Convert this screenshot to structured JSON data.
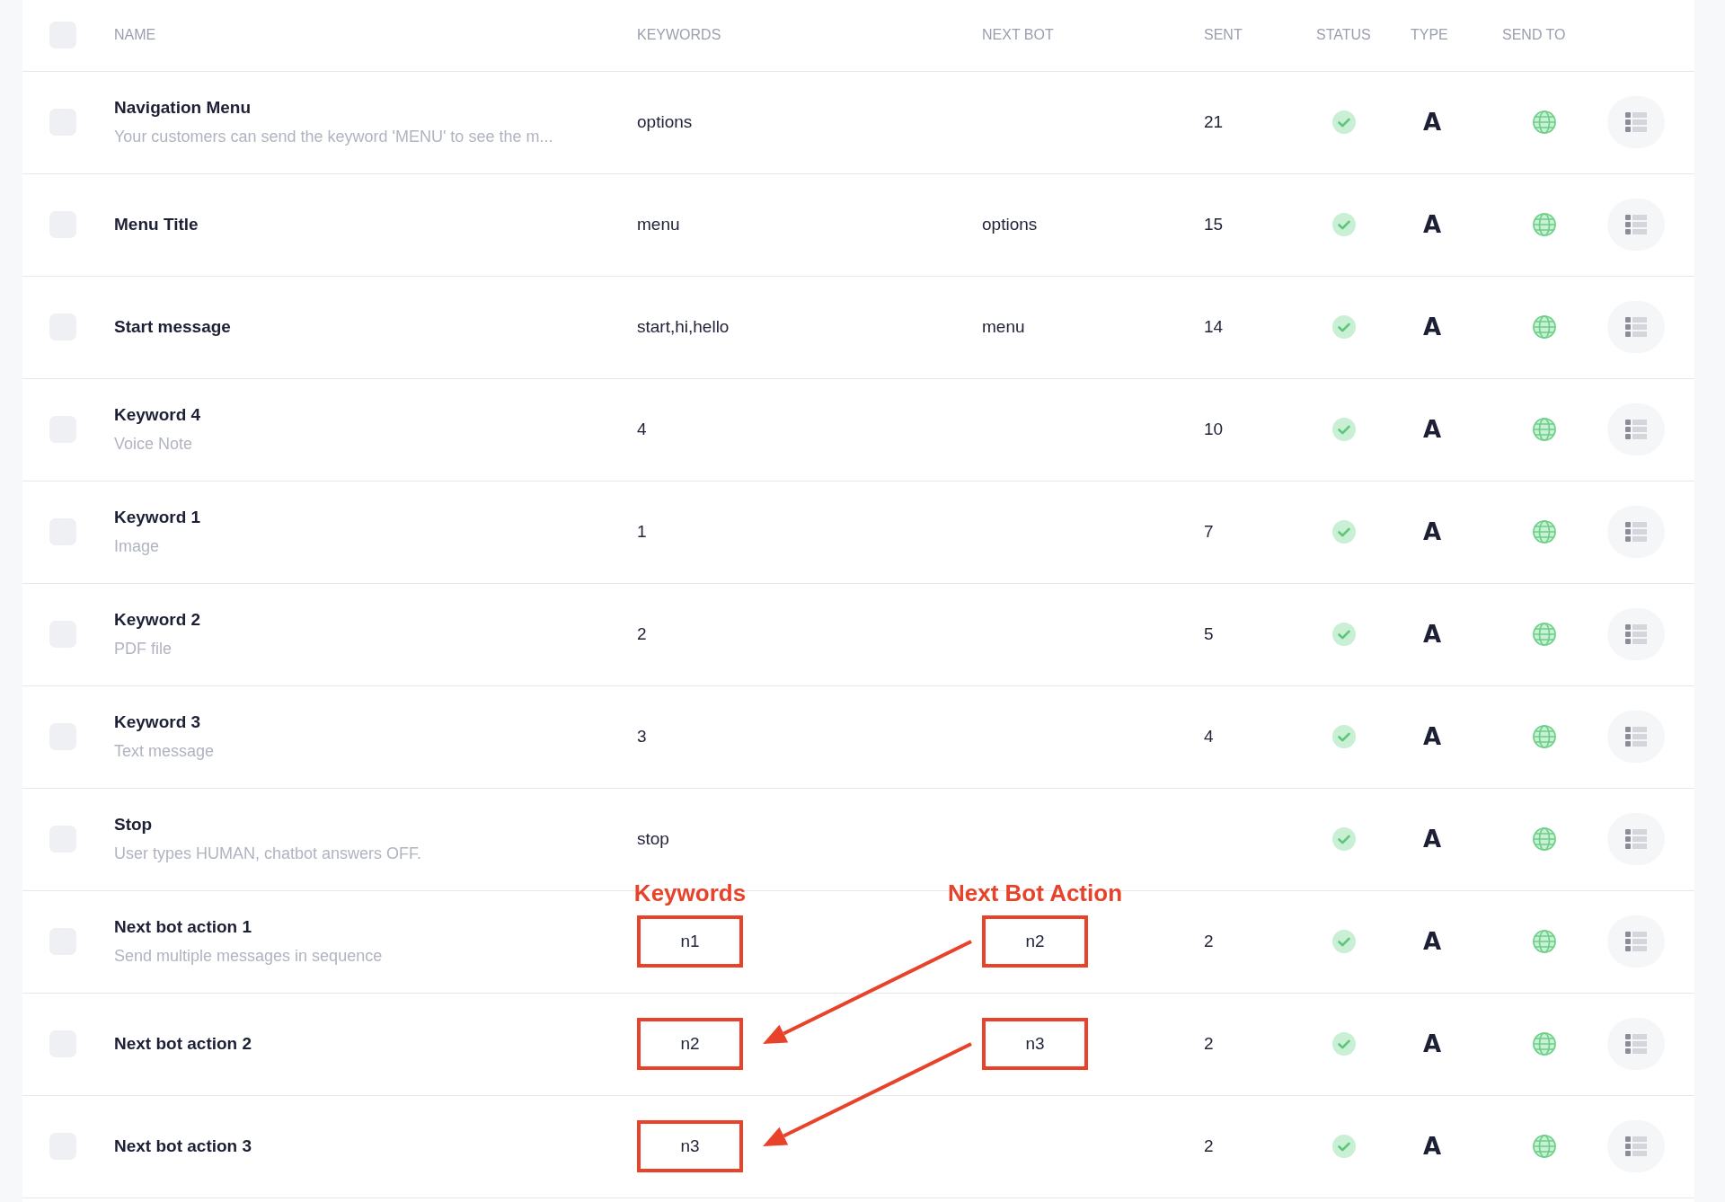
{
  "header": {
    "checked": false,
    "columns": [
      "NAME",
      "KEYWORDS",
      "NEXT BOT",
      "SENT",
      "STATUS",
      "TYPE",
      "SEND TO"
    ]
  },
  "annotations": {
    "keywords_label": "Keywords",
    "next_bot_label": "Next Bot Action"
  },
  "rows": [
    {
      "name": "Navigation Menu",
      "description": "Your customers can send the keyword 'MENU' to see the m...",
      "keywords": "options",
      "sent": "21",
      "active": true,
      "type": "A",
      "checked": false,
      "keywords_highlighted": false,
      "next_bot_highlighted": false,
      "next_bot_arrow": false
    },
    {
      "name": "Menu Title",
      "keywords": "menu",
      "next_bot": "options",
      "sent": "15",
      "active": true,
      "type": "A",
      "checked": false,
      "keywords_highlighted": false,
      "next_bot_highlighted": false,
      "next_bot_arrow": false
    },
    {
      "name": "Start message",
      "keywords": "start,hi,hello",
      "next_bot": "menu",
      "sent": "14",
      "active": true,
      "type": "A",
      "checked": false,
      "keywords_highlighted": false,
      "next_bot_highlighted": false,
      "next_bot_arrow": false
    },
    {
      "name": "Keyword 4",
      "description": "Voice Note",
      "keywords": "4",
      "sent": "10",
      "active": true,
      "type": "A",
      "checked": false,
      "keywords_highlighted": false,
      "next_bot_highlighted": false,
      "next_bot_arrow": false
    },
    {
      "name": "Keyword 1",
      "description": "Image",
      "keywords": "1",
      "sent": "7",
      "active": true,
      "type": "A",
      "checked": false,
      "keywords_highlighted": false,
      "next_bot_highlighted": false,
      "next_bot_arrow": false
    },
    {
      "name": "Keyword 2",
      "description": "PDF file",
      "keywords": "2",
      "sent": "5",
      "active": true,
      "type": "A",
      "checked": false,
      "keywords_highlighted": false,
      "next_bot_highlighted": false,
      "next_bot_arrow": false
    },
    {
      "name": "Keyword 3",
      "description": "Text message",
      "keywords": "3",
      "sent": "4",
      "active": true,
      "type": "A",
      "checked": false,
      "keywords_highlighted": false,
      "next_bot_highlighted": false,
      "next_bot_arrow": false
    },
    {
      "name": "Stop",
      "description": "User types HUMAN, chatbot answers OFF.",
      "keywords": "stop",
      "active": true,
      "type": "A",
      "checked": false,
      "keywords_highlighted": false,
      "next_bot_highlighted": false,
      "next_bot_arrow": false
    },
    {
      "name": "Next bot action 1",
      "description": "Send multiple messages in sequence",
      "keywords": "n1",
      "next_bot": "n2",
      "sent": "2",
      "active": true,
      "type": "A",
      "checked": false,
      "keywords_highlighted": true,
      "next_bot_highlighted": true,
      "next_bot_arrow": true
    },
    {
      "name": "Next bot action 2",
      "keywords": "n2",
      "next_bot": "n3",
      "sent": "2",
      "active": true,
      "type": "A",
      "checked": false,
      "keywords_highlighted": true,
      "next_bot_highlighted": true,
      "next_bot_arrow": true
    },
    {
      "name": "Next bot action 3",
      "keywords": "n3",
      "sent": "2",
      "active": true,
      "type": "A",
      "checked": false,
      "keywords_highlighted": true,
      "next_bot_highlighted": false,
      "next_bot_arrow": false
    }
  ]
}
